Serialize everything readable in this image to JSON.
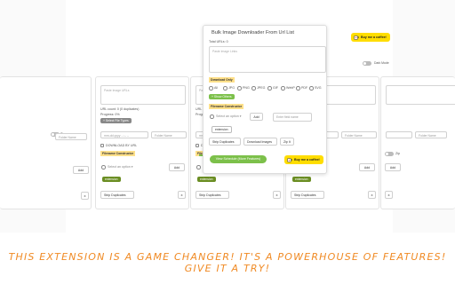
{
  "popup": {
    "title": "Bulk Image Downloader From Url List",
    "total_urls_label": "Total URLs: 0",
    "textarea_placeholder": "Paste Image Links",
    "download_only_label": "Download Only",
    "formats": [
      "All",
      "JPG",
      "PNG",
      "JPEG",
      "GIF",
      "WebP",
      "PDF",
      "SVG"
    ],
    "show_others_label": "+ Show Others",
    "filename_constructor_label": "Filename Constructor",
    "select_option_placeholder": "Select an option",
    "add_button": "Add",
    "edit_field_placeholder": "Enter field name",
    "extension_chip": "extension",
    "strip_duplicates_button": "Strip Duplicates",
    "download_images_button": "Download Images",
    "zip_button": "Zip It",
    "view_schedule_button": "View Schedule (More Features)",
    "kofi_label": "Buy me a coffee!"
  },
  "top": {
    "kofi_label": "Buy me a coffee!",
    "dark_mode_label": "Dark Mode"
  },
  "column": {
    "textarea_placeholder": "Paste Image URLs",
    "url_count": "URL count: 0 (0 duplicates)",
    "progress": "Progress: 0%",
    "select_file_types": "+ Select File Types",
    "date_placeholder": "mm-dd-yyyy --:-- --",
    "folder_placeholder": "Folder Name",
    "download_by_url": "DOWNLOAD BY URL",
    "filename_constructor_label": "Filename Constructor",
    "select_option_placeholder": "Select an option",
    "add_button": "Add",
    "extension_chip": "extension",
    "strip_duplicates_button": "Strip Duplicates",
    "close_icon": "x",
    "zip_label": "Zip"
  },
  "caption": {
    "line1": "This extension is a game changer! It's a powerhouse of features!",
    "line2": "Give it a try!"
  },
  "colors": {
    "accent_green": "#7cc04a",
    "chip_green": "#6b8e23",
    "highlight_yellow": "#ffe08a",
    "kofi_yellow": "#ffdd00",
    "caption_orange": "#f08a24"
  }
}
